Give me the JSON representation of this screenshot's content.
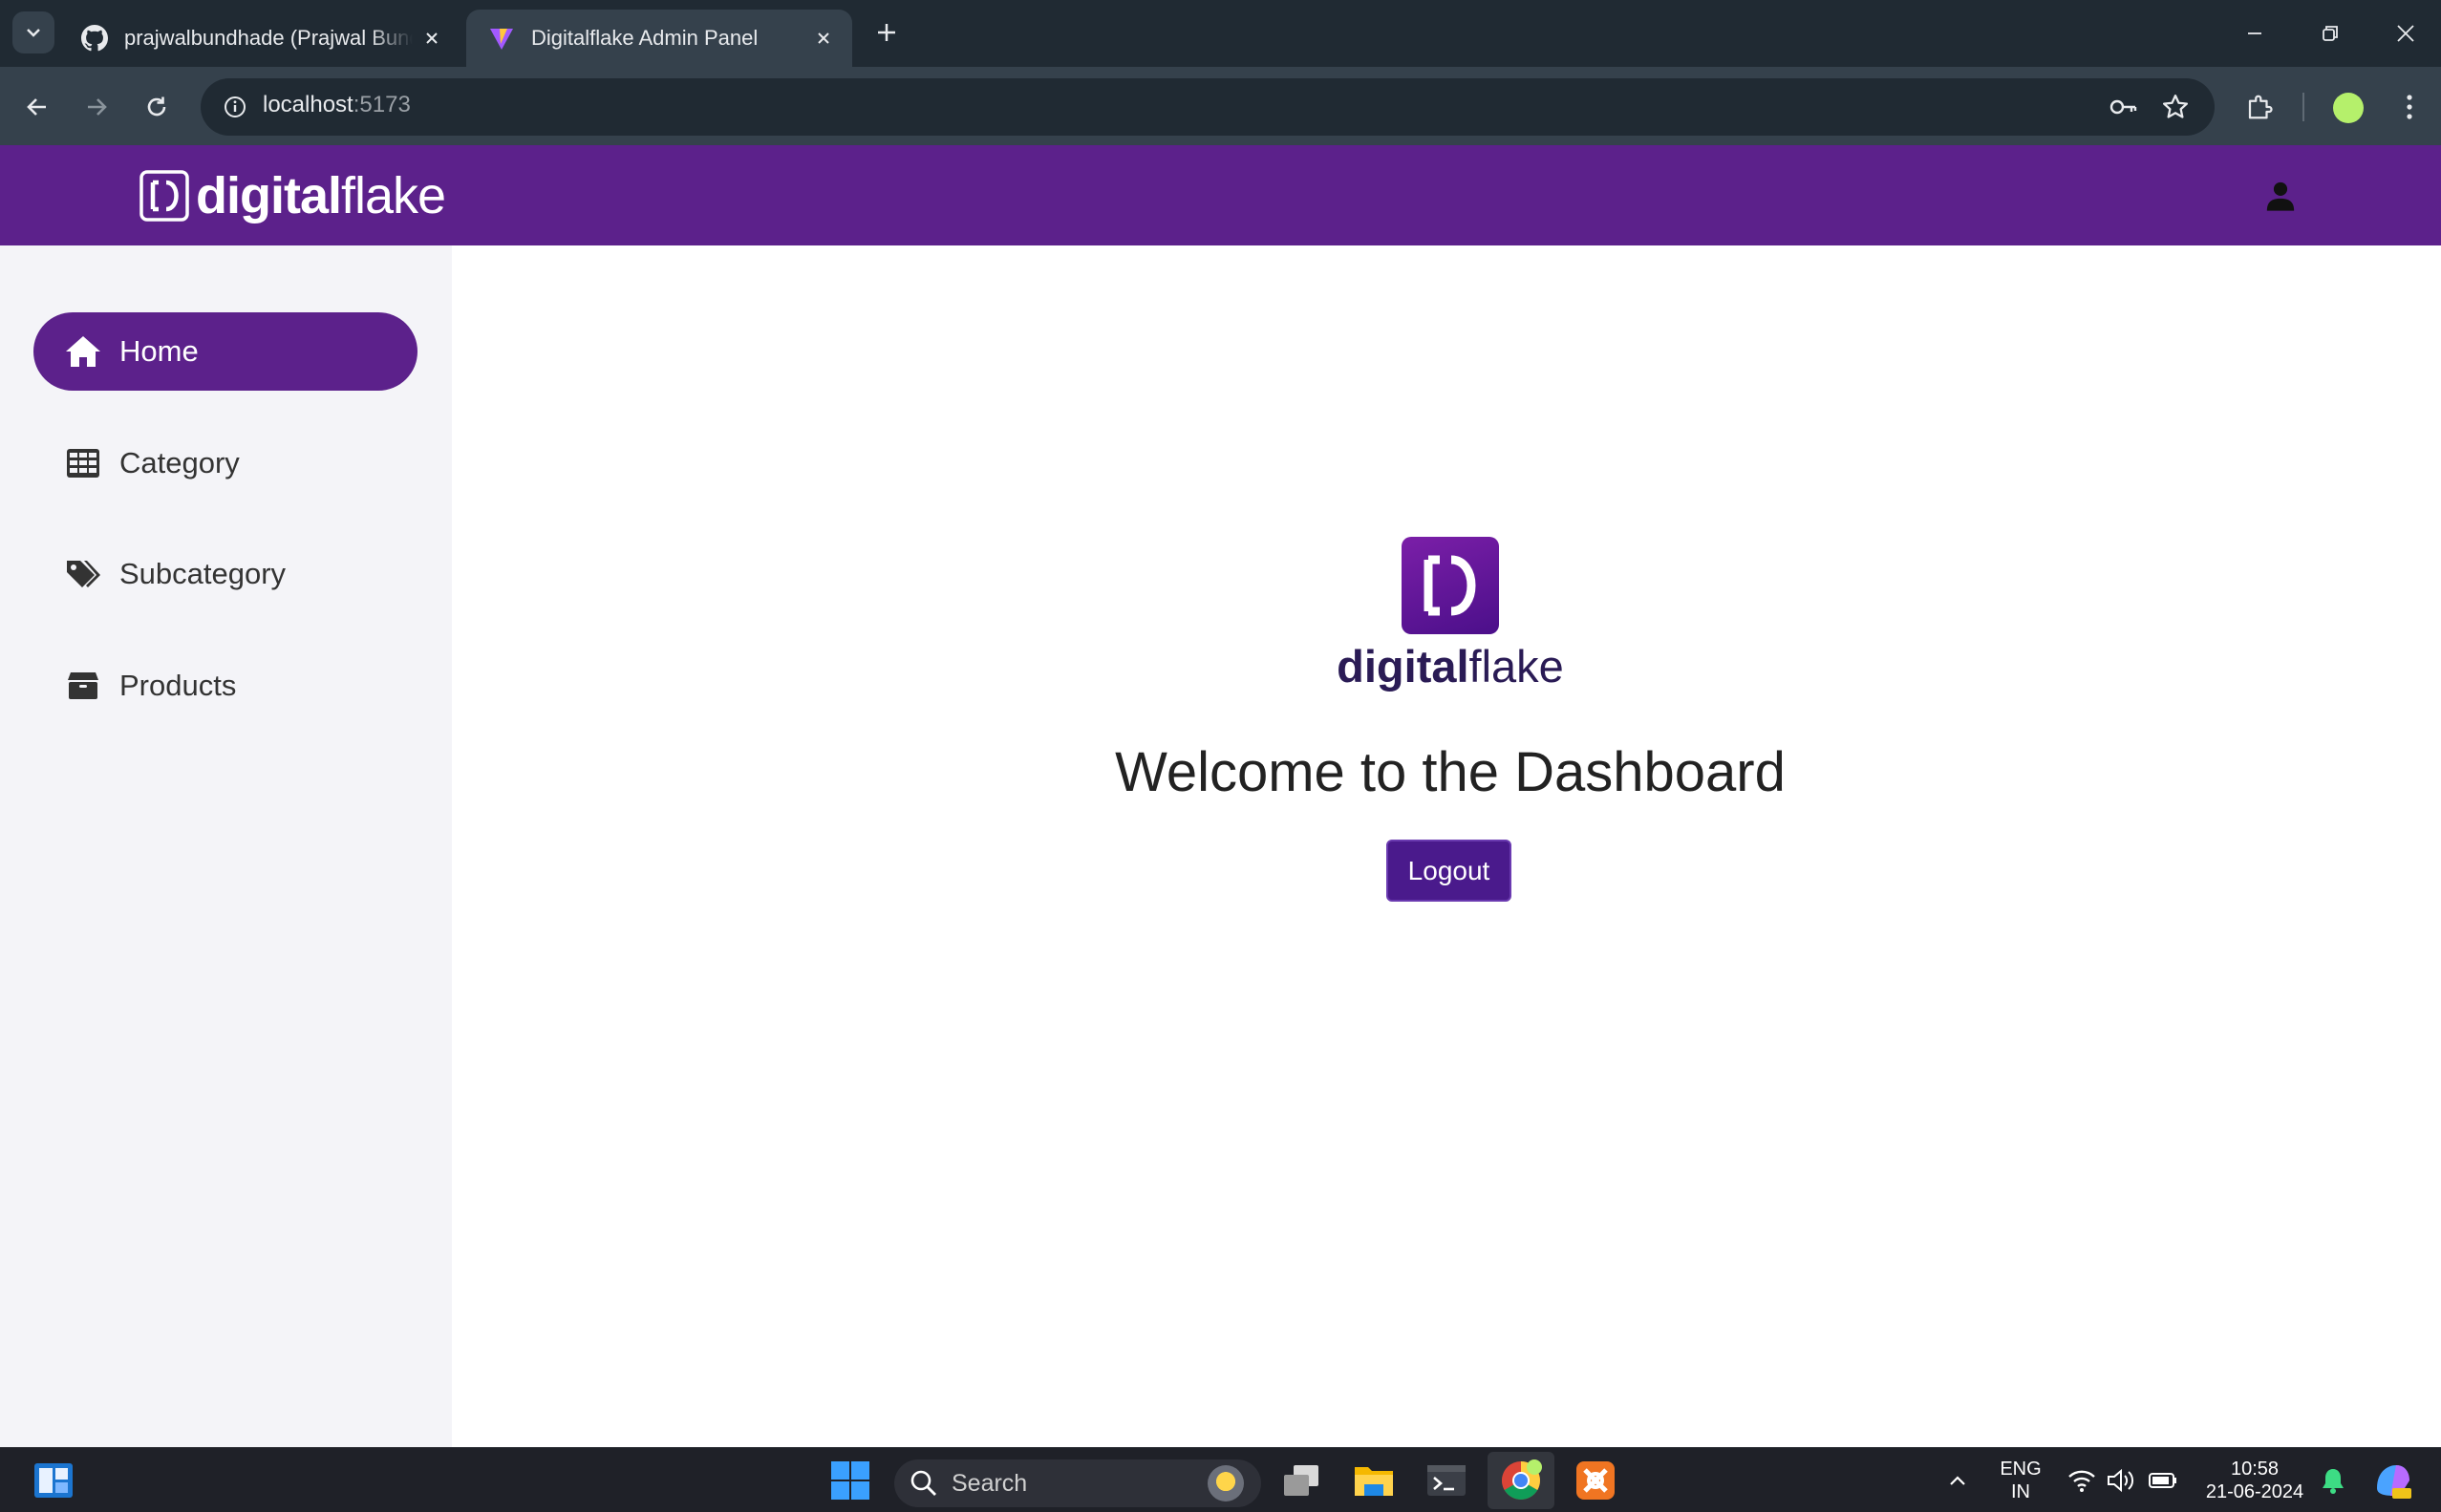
{
  "browser": {
    "tabs": [
      {
        "title": "prajwalbundhade (Prajwal Bundhade)",
        "icon": "github-icon",
        "active": false
      },
      {
        "title": "Digitalflake Admin Panel",
        "icon": "vite-icon",
        "active": true
      }
    ],
    "url_host": "localhost",
    "url_port": ":5173"
  },
  "app": {
    "brand_bold": "digital",
    "brand_light": "flake",
    "header_icon": "user-icon",
    "sidebar": [
      {
        "label": "Home",
        "icon": "home-icon",
        "active": true
      },
      {
        "label": "Category",
        "icon": "grid-icon",
        "active": false
      },
      {
        "label": "Subcategory",
        "icon": "tags-icon",
        "active": false
      },
      {
        "label": "Products",
        "icon": "box-icon",
        "active": false
      }
    ],
    "main": {
      "brand_bold": "digital",
      "brand_light": "flake",
      "welcome": "Welcome to the Dashboard",
      "logout_label": "Logout"
    },
    "colors": {
      "primary": "#5c218b",
      "button": "#4a1a8c",
      "sidebar_bg": "#f4f4f8"
    }
  },
  "taskbar": {
    "search_placeholder": "Search",
    "lang_top": "ENG",
    "lang_bottom": "IN",
    "time": "10:58",
    "date": "21-06-2024"
  }
}
